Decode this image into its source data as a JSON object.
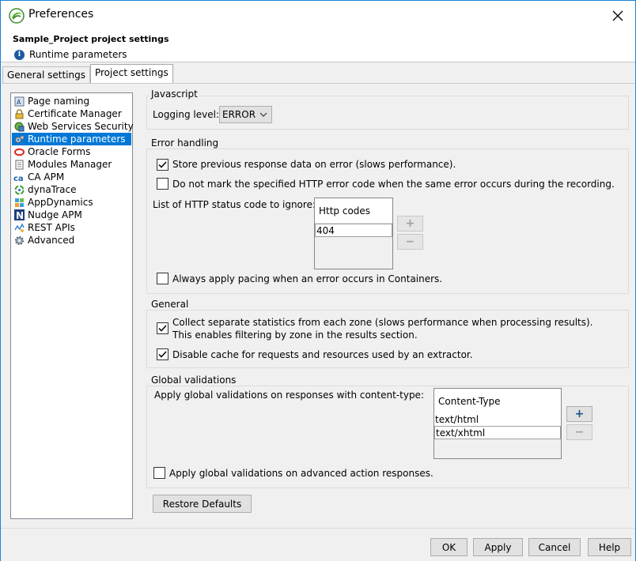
{
  "window": {
    "title": "Preferences"
  },
  "header": {
    "title": "Sample_Project project settings",
    "subtitle": "Runtime parameters"
  },
  "tabs": [
    {
      "label": "General settings"
    },
    {
      "label": "Project settings"
    }
  ],
  "tree": {
    "items": [
      {
        "label": "Page naming"
      },
      {
        "label": "Certificate Manager"
      },
      {
        "label": "Web Services Security"
      },
      {
        "label": "Runtime parameters"
      },
      {
        "label": "Oracle Forms"
      },
      {
        "label": "Modules Manager"
      },
      {
        "label": "CA APM"
      },
      {
        "label": "dynaTrace"
      },
      {
        "label": "AppDynamics"
      },
      {
        "label": "Nudge APM"
      },
      {
        "label": "REST APIs"
      },
      {
        "label": "Advanced"
      }
    ]
  },
  "javascript": {
    "title": "Javascript",
    "logging_label": "Logging level:",
    "logging_value": "ERROR"
  },
  "error_handling": {
    "title": "Error handling",
    "store_response": "Store previous response data on error (slows performance).",
    "no_mark": "Do not mark the specified HTTP error code when the same error occurs during the recording.",
    "list_label": "List of HTTP status code to ignore:",
    "table_header": "Http codes",
    "rows": [
      "404"
    ],
    "pacing": "Always apply pacing when an error occurs in Containers."
  },
  "general": {
    "title": "General",
    "collect_line1": "Collect separate statistics from each zone (slows performance when processing results).",
    "collect_line2": "This enables filtering by zone in the results section.",
    "disable_cache": "Disable cache for requests and resources used by an extractor."
  },
  "global_validations": {
    "title": "Global validations",
    "apply_label": "Apply global validations on responses with content-type:",
    "table_header": "Content-Type",
    "rows": [
      "text/html",
      "text/xhtml"
    ],
    "advanced": "Apply global validations on advanced action responses."
  },
  "restore_label": "Restore Defaults",
  "footer": {
    "ok": "OK",
    "apply": "Apply",
    "cancel": "Cancel",
    "help": "Help"
  },
  "colors": {
    "selection": "#0078d7",
    "window_border": "#1883d7"
  }
}
